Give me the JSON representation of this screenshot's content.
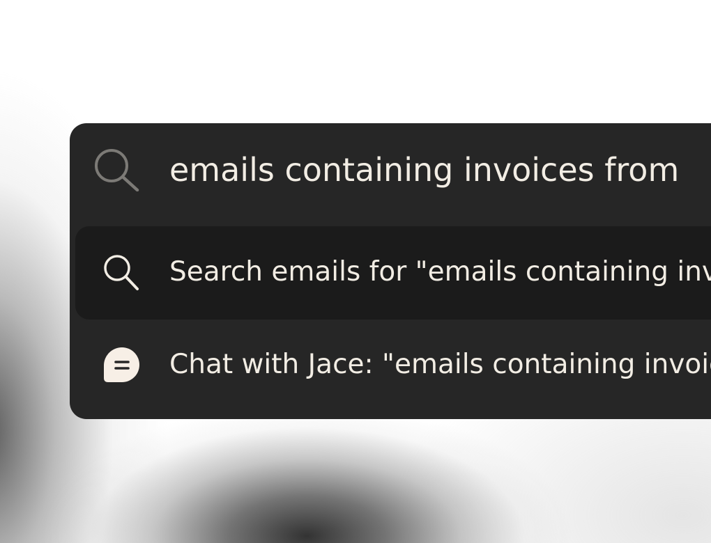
{
  "command_palette": {
    "search": {
      "value": "emails containing invoices from",
      "icon": "search-icon"
    },
    "results": [
      {
        "icon": "search-icon",
        "label": "Search emails for \"emails containing invoices from\"",
        "selected": true
      },
      {
        "icon": "chat-bubble-icon",
        "label": "Chat with Jace: \"emails containing invoices from\"",
        "selected": false
      }
    ]
  },
  "colors": {
    "panel": "#262626",
    "selected_row": "#1b1b1b",
    "text": "#f2ede4",
    "muted_icon": "#7c7a76"
  }
}
